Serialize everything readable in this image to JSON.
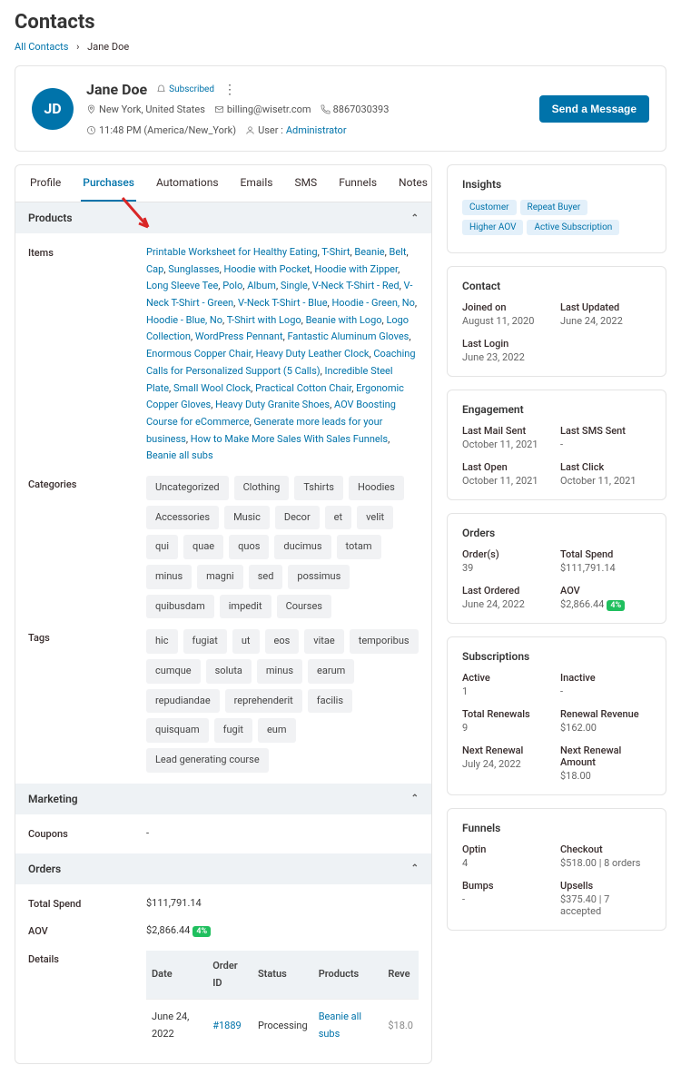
{
  "page_title": "Contacts",
  "breadcrumb": {
    "root": "All Contacts",
    "current": "Jane Doe"
  },
  "contact": {
    "initials": "JD",
    "name": "Jane Doe",
    "status_label": "Subscribed",
    "location": "New York, United States",
    "email": "billing@wisetr.com",
    "phone": "8867030393",
    "time": "11:48 PM (America/New_York)",
    "user_label": "User :",
    "user_link": "Administrator",
    "cta": "Send a Message"
  },
  "tabs": [
    "Profile",
    "Purchases",
    "Automations",
    "Emails",
    "SMS",
    "Funnels",
    "Notes"
  ],
  "active_tab": "Purchases",
  "sections": {
    "products": {
      "title": "Products",
      "items_label": "Items",
      "items": [
        "Printable Worksheet for Healthy Eating",
        "T-Shirt",
        "Beanie",
        "Belt",
        "Cap",
        "Sunglasses",
        "Hoodie with Pocket",
        "Hoodie with Zipper",
        "Long Sleeve Tee",
        "Polo",
        "Album",
        "Single",
        "V-Neck T-Shirt - Red",
        "V-Neck T-Shirt - Green",
        "V-Neck T-Shirt - Blue",
        "Hoodie - Green, No",
        "Hoodie - Blue, No",
        "T-Shirt with Logo",
        "Beanie with Logo",
        "Logo Collection",
        "WordPress Pennant",
        "Fantastic Aluminum Gloves",
        "Enormous Copper Chair",
        "Heavy Duty Leather Clock",
        "Coaching Calls for Personalized Support (5 Calls)",
        "Incredible Steel Plate",
        "Small Wool Clock",
        "Practical Cotton Chair",
        "Ergonomic Copper Gloves",
        "Heavy Duty Granite Shoes",
        "AOV Boosting Course for eCommerce",
        "Generate more leads for your business",
        "How to Make More Sales With Sales Funnels",
        "Beanie all subs"
      ],
      "categories_label": "Categories",
      "categories": [
        "Uncategorized",
        "Clothing",
        "Tshirts",
        "Hoodies",
        "Accessories",
        "Music",
        "Decor",
        "et",
        "velit",
        "qui",
        "quae",
        "quos",
        "ducimus",
        "totam",
        "minus",
        "magni",
        "sed",
        "possimus",
        "quibusdam",
        "impedit",
        "Courses"
      ],
      "tags_label": "Tags",
      "tags": [
        "hic",
        "fugiat",
        "ut",
        "eos",
        "vitae",
        "temporibus",
        "cumque",
        "soluta",
        "minus",
        "earum",
        "repudiandae",
        "reprehenderit",
        "facilis",
        "quisquam",
        "fugit",
        "eum",
        "Lead generating course"
      ]
    },
    "marketing": {
      "title": "Marketing",
      "coupons_label": "Coupons",
      "coupons_val": "-"
    },
    "orders": {
      "title": "Orders",
      "total_spend_label": "Total Spend",
      "total_spend": "$111,791.14",
      "aov_label": "AOV",
      "aov": "$2,866.44",
      "aov_badge": "4%",
      "details_label": "Details",
      "columns": [
        "Date",
        "Order ID",
        "Status",
        "Products",
        "Reve"
      ],
      "rows": [
        {
          "date": "June 24, 2022",
          "order_id": "#1889",
          "status": "Processing",
          "products": "Beanie all subs",
          "rev": "$18.0"
        }
      ]
    }
  },
  "sidebar": {
    "insights": {
      "title": "Insights",
      "pills": [
        "Customer",
        "Repeat Buyer",
        "Higher AOV",
        "Active Subscription"
      ]
    },
    "contact": {
      "title": "Contact",
      "joined_label": "Joined on",
      "joined": "August 11, 2020",
      "updated_label": "Last Updated",
      "updated": "June 24, 2022",
      "login_label": "Last Login",
      "login": "June 23, 2022"
    },
    "engagement": {
      "title": "Engagement",
      "mail_label": "Last Mail Sent",
      "mail": "October 11, 2021",
      "sms_label": "Last SMS Sent",
      "sms": "-",
      "open_label": "Last Open",
      "open": "October 11, 2021",
      "click_label": "Last Click",
      "click": "October 11, 2021"
    },
    "orders": {
      "title": "Orders",
      "orders_label": "Order(s)",
      "orders": "39",
      "spend_label": "Total Spend",
      "spend": "$111,791.14",
      "last_label": "Last Ordered",
      "last": "June 24, 2022",
      "aov_label": "AOV",
      "aov": "$2,866.44",
      "aov_badge": "4%"
    },
    "subscriptions": {
      "title": "Subscriptions",
      "active_label": "Active",
      "active": "1",
      "inactive_label": "Inactive",
      "inactive": "-",
      "renewals_label": "Total Renewals",
      "renewals": "9",
      "rrev_label": "Renewal Revenue",
      "rrev": "$162.00",
      "next_label": "Next Renewal",
      "next": "July 24, 2022",
      "namt_label": "Next Renewal Amount",
      "namt": "$18.00"
    },
    "funnels": {
      "title": "Funnels",
      "optin_label": "Optin",
      "optin": "4",
      "checkout_label": "Checkout",
      "checkout": "$518.00 | 8 orders",
      "bumps_label": "Bumps",
      "bumps": "-",
      "upsells_label": "Upsells",
      "upsells": "$375.40 | 7 accepted"
    }
  }
}
